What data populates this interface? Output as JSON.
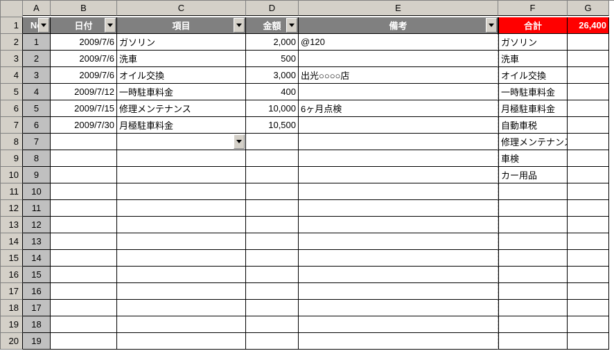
{
  "columns": [
    "A",
    "B",
    "C",
    "D",
    "E",
    "F",
    "G"
  ],
  "headers": {
    "A": "No",
    "B": "日付",
    "C": "項目",
    "D": "金額",
    "E": "備考",
    "F": "合計",
    "G": "26,400"
  },
  "rows": [
    {
      "no": "1",
      "date": "2009/7/6",
      "item": "ガソリン",
      "amount": "2,000",
      "note": "@120",
      "f": "ガソリン"
    },
    {
      "no": "2",
      "date": "2009/7/6",
      "item": "洗車",
      "amount": "500",
      "note": "",
      "f": "洗車"
    },
    {
      "no": "3",
      "date": "2009/7/6",
      "item": "オイル交換",
      "amount": "3,000",
      "note": "出光○○○○店",
      "f": "オイル交換"
    },
    {
      "no": "4",
      "date": "2009/7/12",
      "item": "一時駐車料金",
      "amount": "400",
      "note": "",
      "f": "一時駐車料金"
    },
    {
      "no": "5",
      "date": "2009/7/15",
      "item": "修理メンテナンス",
      "amount": "10,000",
      "note": "6ヶ月点検",
      "f": "月極駐車料金"
    },
    {
      "no": "6",
      "date": "2009/7/30",
      "item": "月極駐車料金",
      "amount": "10,500",
      "note": "",
      "f": "自動車税"
    },
    {
      "no": "7",
      "date": "",
      "item": "",
      "amount": "",
      "note": "",
      "f": "修理メンテナンス",
      "dropdown": true
    },
    {
      "no": "8",
      "date": "",
      "item": "",
      "amount": "",
      "note": "",
      "f": "車検"
    },
    {
      "no": "9",
      "date": "",
      "item": "",
      "amount": "",
      "note": "",
      "f": "カー用品"
    },
    {
      "no": "10",
      "date": "",
      "item": "",
      "amount": "",
      "note": "",
      "f": ""
    },
    {
      "no": "11",
      "date": "",
      "item": "",
      "amount": "",
      "note": "",
      "f": ""
    },
    {
      "no": "12",
      "date": "",
      "item": "",
      "amount": "",
      "note": "",
      "f": ""
    },
    {
      "no": "13",
      "date": "",
      "item": "",
      "amount": "",
      "note": "",
      "f": ""
    },
    {
      "no": "14",
      "date": "",
      "item": "",
      "amount": "",
      "note": "",
      "f": ""
    },
    {
      "no": "15",
      "date": "",
      "item": "",
      "amount": "",
      "note": "",
      "f": ""
    },
    {
      "no": "16",
      "date": "",
      "item": "",
      "amount": "",
      "note": "",
      "f": ""
    },
    {
      "no": "17",
      "date": "",
      "item": "",
      "amount": "",
      "note": "",
      "f": ""
    },
    {
      "no": "18",
      "date": "",
      "item": "",
      "amount": "",
      "note": "",
      "f": ""
    },
    {
      "no": "19",
      "date": "",
      "item": "",
      "amount": "",
      "note": "",
      "f": ""
    }
  ]
}
